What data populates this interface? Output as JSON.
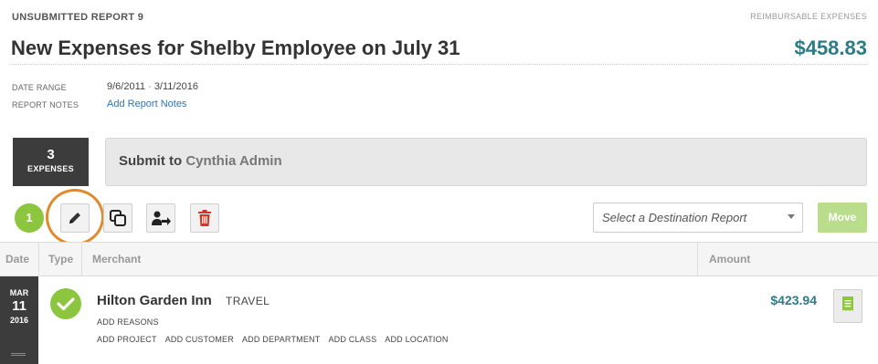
{
  "header": {
    "report_label": "UNSUBMITTED REPORT 9",
    "reimbursable_label": "REIMBURSABLE EXPENSES",
    "title": "New Expenses for Shelby Employee on July 31",
    "total": "$458.83"
  },
  "meta": {
    "date_range_label": "DATE RANGE",
    "date_start": "9/6/2011",
    "date_separator": "-",
    "date_end": "3/11/2016",
    "notes_label": "REPORT NOTES",
    "notes_link": "Add Report Notes"
  },
  "summary": {
    "expense_count": "3",
    "expense_label": "EXPENSES",
    "submit_prefix": "Submit to ",
    "submit_to": "Cynthia Admin"
  },
  "toolbar": {
    "step_number": "1",
    "destination_placeholder": "Select a Destination Report",
    "move_label": "Move",
    "icons": [
      "edit-icon",
      "duplicate-icon",
      "reassign-icon",
      "delete-icon"
    ]
  },
  "table": {
    "columns": [
      "Date",
      "Type",
      "Merchant",
      "Amount"
    ]
  },
  "expenses": [
    {
      "month": "MAR",
      "day": "11",
      "year": "2016",
      "merchant": "Hilton Garden Inn",
      "category": "TRAVEL",
      "add_reasons": "ADD REASONS",
      "add_links": [
        "ADD PROJECT",
        "ADD CUSTOMER",
        "ADD DEPARTMENT",
        "ADD CLASS",
        "ADD LOCATION"
      ],
      "amount": "$423.94"
    }
  ],
  "colors": {
    "accent_teal": "#2a7c86",
    "success_green": "#8cc63f",
    "highlight_orange": "#e08a2b",
    "delete_red": "#d9302b",
    "dark_panel": "#3c3c3c"
  }
}
